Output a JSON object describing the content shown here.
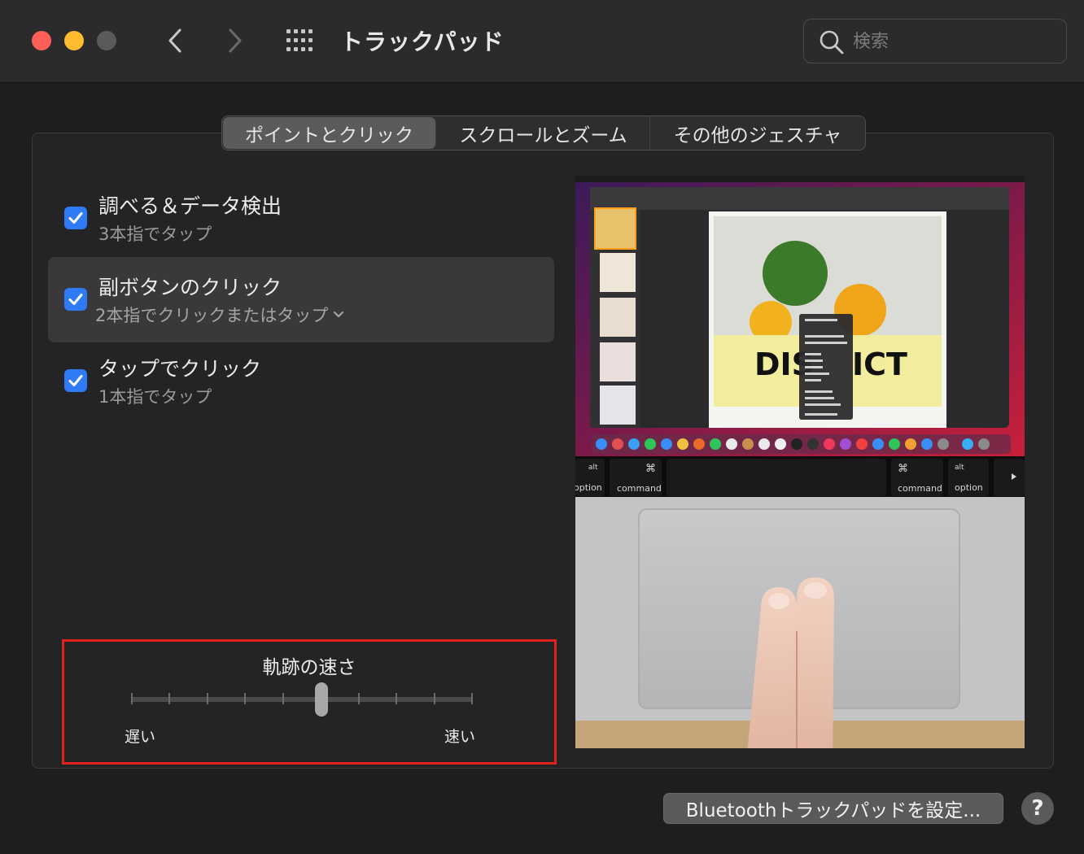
{
  "window": {
    "title": "トラックパッド",
    "search_placeholder": "検索"
  },
  "tabs": [
    {
      "label": "ポイントとクリック",
      "active": true
    },
    {
      "label": "スクロールとズーム",
      "active": false
    },
    {
      "label": "その他のジェスチャ",
      "active": false
    }
  ],
  "options": [
    {
      "title": "調べる＆データ検出",
      "subtitle": "3本指でタップ",
      "checked": true
    },
    {
      "title": "副ボタンのクリック",
      "subtitle": "2本指でクリックまたはタップ",
      "checked": true,
      "has_popup": true
    },
    {
      "title": "タップでクリック",
      "subtitle": "1本指でタップ",
      "checked": true
    }
  ],
  "tracking_speed": {
    "title": "軌跡の速さ",
    "min_label": "遅い",
    "max_label": "速い",
    "tick_count": 10,
    "position": 0.556
  },
  "preview": {
    "poster_word_left": "DIS",
    "poster_word_right": "ICT",
    "key_alt": "alt",
    "key_option": "option",
    "key_command": "command",
    "key_cmd_symbol": "⌘"
  },
  "buttons": {
    "bluetooth": "Bluetoothトラックパッドを設定...",
    "help": "?"
  },
  "colors": {
    "accent": "#2f7bf5",
    "highlight_border": "#e0231c",
    "close": "#ff5f57",
    "minimize": "#febc2e"
  }
}
